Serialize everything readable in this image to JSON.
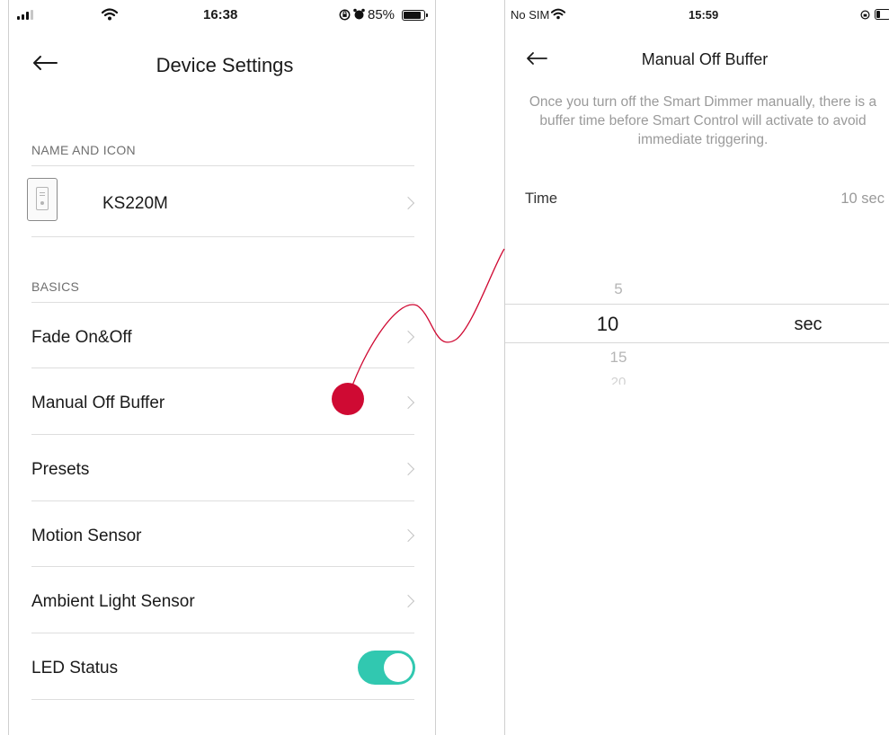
{
  "left_phone": {
    "status_bar": {
      "time": "16:38",
      "battery": "85%",
      "battery_level": 0.85
    },
    "nav": {
      "title": "Device Settings"
    },
    "name_and_icon": {
      "header": "NAME AND ICON",
      "device_name": "KS220M"
    },
    "basics": {
      "header": "BASICS",
      "items": [
        {
          "label": "Fade On&Off"
        },
        {
          "label": "Manual Off Buffer"
        },
        {
          "label": "Presets"
        },
        {
          "label": "Motion Sensor"
        },
        {
          "label": "Ambient Light Sensor"
        },
        {
          "label": "LED Status",
          "toggle_on": true
        }
      ]
    }
  },
  "right_phone": {
    "status_bar": {
      "carrier": "No SIM",
      "time": "15:59"
    },
    "nav": {
      "title": "Manual Off Buffer"
    },
    "description": "Once you turn off the Smart Dimmer manually, there is a buffer time before Smart Control will activate to avoid immediate triggering.",
    "time_row": {
      "label": "Time",
      "value": "10 sec"
    },
    "picker": {
      "above": "5",
      "selected": "10",
      "below": "15",
      "next": "20",
      "unit": "sec"
    }
  },
  "colors": {
    "toggle_accent": "#31c8b0",
    "highlight_dot": "#cf0a33",
    "connector_line": "#cf0a33"
  },
  "icons": [
    "signal-icon",
    "wifi-icon",
    "battery-icon",
    "alarm-icon",
    "orientation-lock-icon",
    "back-arrow-icon",
    "chevron-right-icon",
    "device-switch-icon"
  ]
}
